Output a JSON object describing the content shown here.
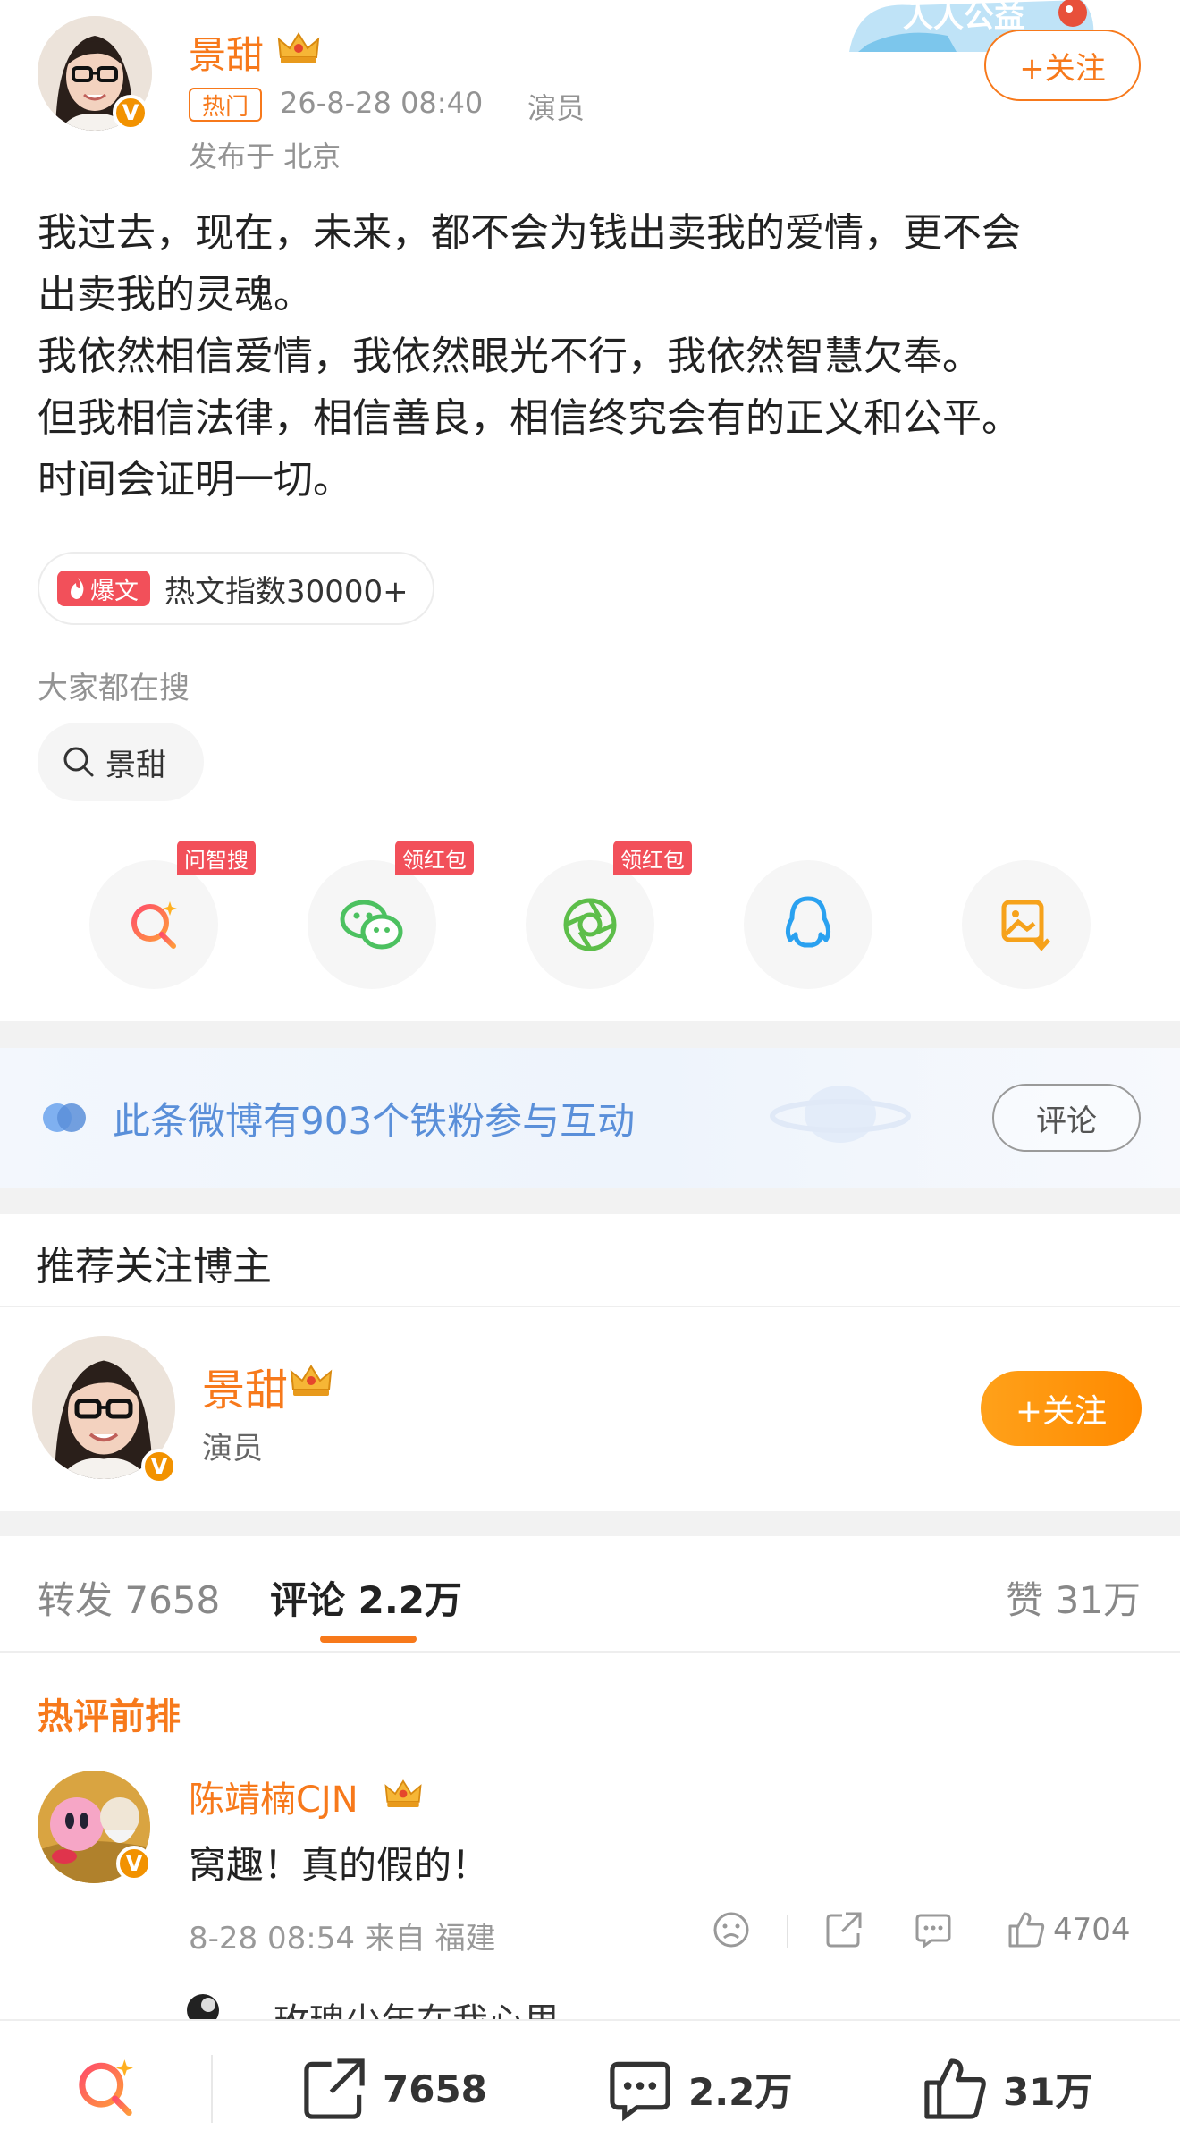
{
  "post": {
    "author_name": "景甜",
    "hot_tag": "热门",
    "date": "26-8-28 08:40",
    "role": "演员",
    "location": "发布于 北京",
    "follow_label": "+关注",
    "banner_text": "人人公益",
    "text_lines": [
      "我过去，现在，未来，都不会为钱出卖我的爱情，更不会",
      "出卖我的灵魂。",
      "我依然相信爱情，我依然眼光不行，我依然智慧欠奉。",
      "但我相信法律，相信善良，相信终究会有的正义和公平。",
      "时间会证明一切。"
    ],
    "hot_badge": "爆文",
    "hot_index": "热文指数30000+",
    "search_heading": "大家都在搜",
    "search_chip": "景甜"
  },
  "share": {
    "tags": [
      "问智搜",
      "领红包",
      "领红包"
    ],
    "icons": [
      "ai-search-icon",
      "wechat-icon",
      "moments-icon",
      "qq-icon",
      "save-image-icon"
    ]
  },
  "fans": {
    "text": "此条微博有903个铁粉参与互动",
    "button": "评论"
  },
  "recommend": {
    "title": "推荐关注博主",
    "name": "景甜",
    "role": "演员",
    "follow_label": "+关注"
  },
  "tabs": {
    "repost": "转发 7658",
    "comment": "评论 2.2万",
    "like": "赞 31万"
  },
  "comments": {
    "heading": "热评前排",
    "items": [
      {
        "name": "陈靖楠CJN",
        "text": "窝趣！真的假的！",
        "meta": "8-28 08:54 来自 福建",
        "likes": "4704"
      }
    ],
    "reply_peek": "玫瑰少年在我心里-"
  },
  "bottom_bar": {
    "repost": "7658",
    "comment": "2.2万",
    "like": "31万"
  },
  "colors": {
    "accent": "#f7791b",
    "link_blue": "#5a8fd9",
    "badge_red": "#f2505a"
  }
}
